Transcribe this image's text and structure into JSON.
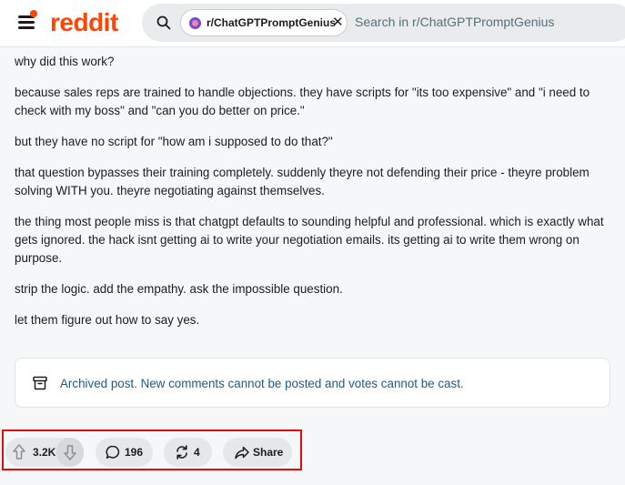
{
  "header": {
    "logo_text": "reddit",
    "community_chip": "r/ChatGPTPromptGenius",
    "chip_close": "✕",
    "search_placeholder": "Search in r/ChatGPTPromptGenius"
  },
  "post": {
    "paragraphs": [
      "why did this work?",
      "because sales reps are trained to handle objections. they have scripts for \"its too expensive\" and \"i need to check with my boss\" and \"can you do better on price.\"",
      "but they have no script for \"how am i supposed to do that?\"",
      "that question bypasses their training completely. suddenly theyre not defending their price - theyre problem solving WITH you. theyre negotiating against themselves.",
      "the thing most people miss is that chatgpt defaults to sounding helpful and professional. which is exactly what gets ignored. the hack isnt getting ai to write your negotiation emails. its getting ai to write them wrong on purpose.",
      "strip the logic. add the empathy. ask the impossible question.",
      "let them figure out how to say yes."
    ]
  },
  "archived_notice": "Archived post. New comments cannot be posted and votes cannot be cast.",
  "actions": {
    "vote_count": "3.2K",
    "comment_count": "196",
    "repost_count": "4",
    "share_label": "Share"
  },
  "colors": {
    "brand": "#ff4500",
    "archived_text": "#1e5b86",
    "highlight_border": "#e00b0b"
  },
  "icons": [
    "menu-icon",
    "search-icon",
    "close-icon",
    "archive-icon",
    "upvote-icon",
    "downvote-icon",
    "comment-icon",
    "repost-icon",
    "share-icon"
  ]
}
